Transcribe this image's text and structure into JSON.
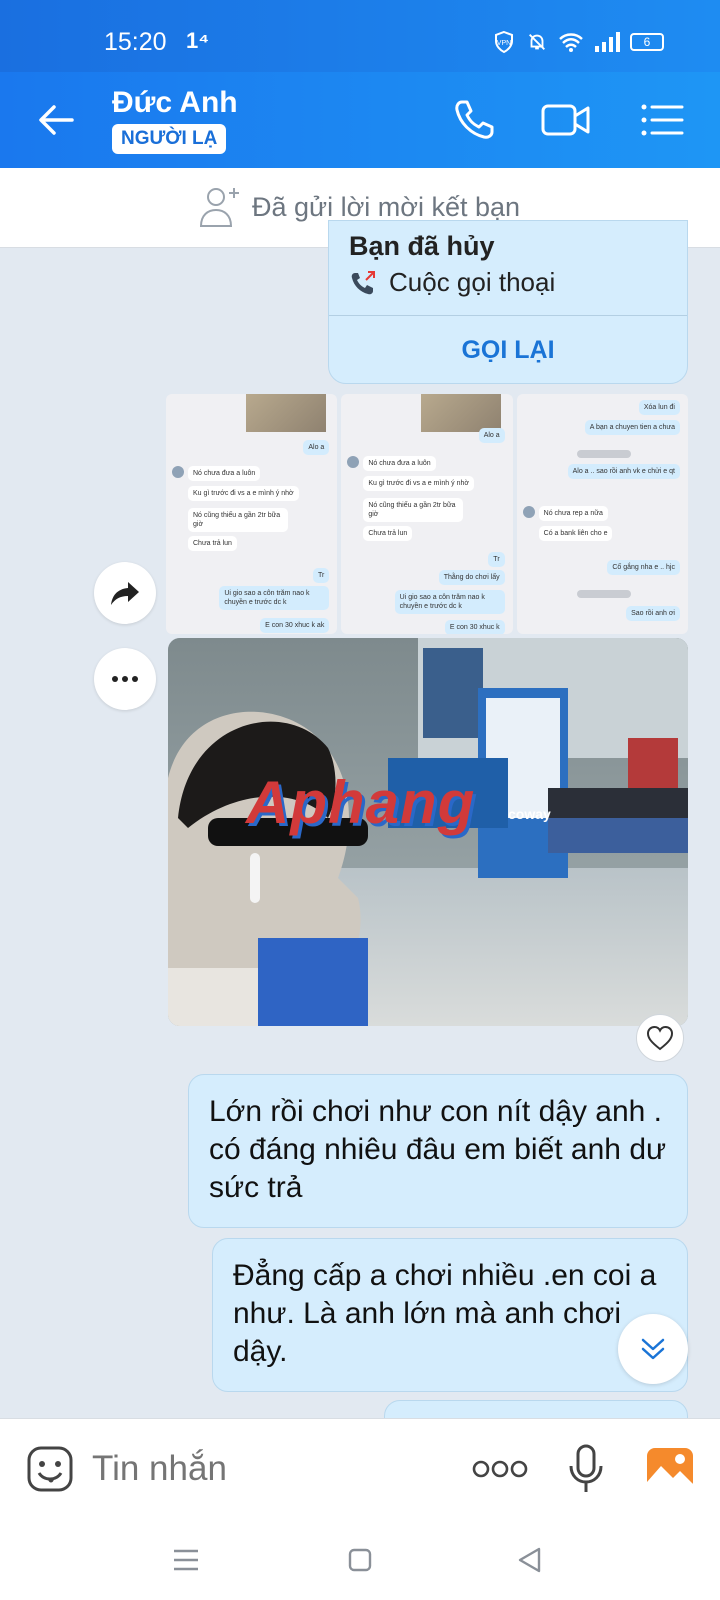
{
  "status_bar": {
    "time": "15:20",
    "notification": "1⁴",
    "battery": "6",
    "icons": [
      "vpn-icon",
      "bell-off-icon",
      "wifi-icon",
      "signal-icon",
      "battery-icon"
    ]
  },
  "header": {
    "contact_name": "Đức Anh",
    "badge": "NGƯỜI LẠ",
    "actions": [
      "back-icon",
      "phone-icon",
      "video-call-icon",
      "menu-list-icon"
    ]
  },
  "friend_request": {
    "text": "Đã gửi lời mời kết bạn"
  },
  "call_card": {
    "title_cut": "Bạn đã hủy",
    "subtitle": "Cuộc gọi thoại",
    "button_label": "GỌI LẠI"
  },
  "screenshots": {
    "thumb1": [
      "Alo a",
      "Nó chưa đưa a luôn",
      "Ku gì trước đi vs a e mình ý nhờ",
      "Nó cũng thiếu a gần 2tr bữa giờ",
      "Chưa trả lun",
      "Tr",
      "Ui gio sao a côn trăm nao k chuyền e trước dc k",
      "E con 30 xhuc k ak"
    ],
    "thumb2": [
      "Alo a",
      "Nó chưa đưa a luôn",
      "Ku gì trước đi vs a e mình ý nhờ",
      "Nó cũng thiếu a gần 2tr bữa giờ",
      "Chưa trả lun",
      "Tr",
      "Thằng do chơi lấy",
      "Ui gio sao a côn trăm nao k chuyền e trước dc k",
      "E con 30 xhuc k"
    ],
    "thumb3": [
      "Xóa lun đi",
      "A bạn a chuyen tien a chưa",
      "Alo a .. sao rồi anh vk e chửi e qt",
      "Nó chưa rep a nữa",
      "Có a bank liên cho e",
      "Cố gắng nha e .. hjc",
      "Sao rồi anh ơi"
    ]
  },
  "photo": {
    "watermark": "Aphang",
    "sign": "coway"
  },
  "messages": [
    {
      "text": "Lớn rồi chơi như con nít dậy anh . có đáng nhiêu đâu em biết anh dư sức trả"
    },
    {
      "text": "Đẳng cấp a chơi nhiều .en  coi a như. Là anh lớn mà anh chơi dậy."
    }
  ],
  "composer": {
    "placeholder": "Tin nhắn",
    "icons": [
      "emoji-icon",
      "more-options-icon",
      "microphone-icon",
      "gallery-icon"
    ]
  },
  "colors": {
    "header_blue": "#1a78ee",
    "bubble_blue": "#d5edfd",
    "accent_blue": "#1a74d6",
    "chat_background": "#e2e9f1"
  }
}
